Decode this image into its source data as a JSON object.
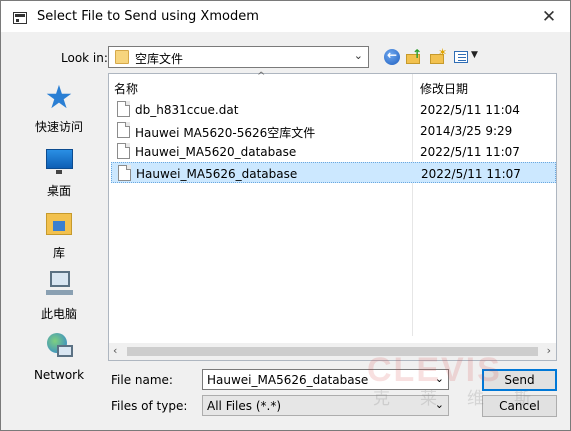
{
  "window": {
    "title": "Select File to Send using Xmodem",
    "close_glyph": "✕"
  },
  "lookin": {
    "label": "Look in:",
    "value": "空库文件"
  },
  "toolbar": {
    "back_icon": "back-arrow-icon",
    "up_icon": "up-folder-icon",
    "new_folder_icon": "new-folder-icon",
    "view_icon": "view-menu-icon"
  },
  "places": [
    {
      "label": "快速访问",
      "icon": "star-icon"
    },
    {
      "label": "桌面",
      "icon": "desktop-icon"
    },
    {
      "label": "库",
      "icon": "library-icon"
    },
    {
      "label": "此电脑",
      "icon": "computer-icon"
    },
    {
      "label": "Network",
      "icon": "network-icon"
    }
  ],
  "filelist": {
    "columns": [
      "名称",
      "修改日期"
    ],
    "rows": [
      {
        "name": "db_h831ccue.dat",
        "date": "2022/5/11 11:04",
        "selected": false
      },
      {
        "name": "Hauwei MA5620-5626空库文件",
        "date": "2014/3/25 9:29",
        "selected": false
      },
      {
        "name": "Hauwei_MA5620_database",
        "date": "2022/5/11 11:07",
        "selected": false
      },
      {
        "name": "Hauwei_MA5626_database",
        "date": "2022/5/11 11:07",
        "selected": true
      }
    ]
  },
  "filename": {
    "label": "File name:",
    "value": "Hauwei_MA5626_database"
  },
  "filetype": {
    "label": "Files of type:",
    "value": "All Files (*.*)"
  },
  "buttons": {
    "send": "Send",
    "cancel": "Cancel"
  },
  "watermark": {
    "logo": "CLEVIS",
    "text": "克莱维斯"
  },
  "colors": {
    "accent": "#0078d7",
    "selection": "#cce8ff"
  }
}
